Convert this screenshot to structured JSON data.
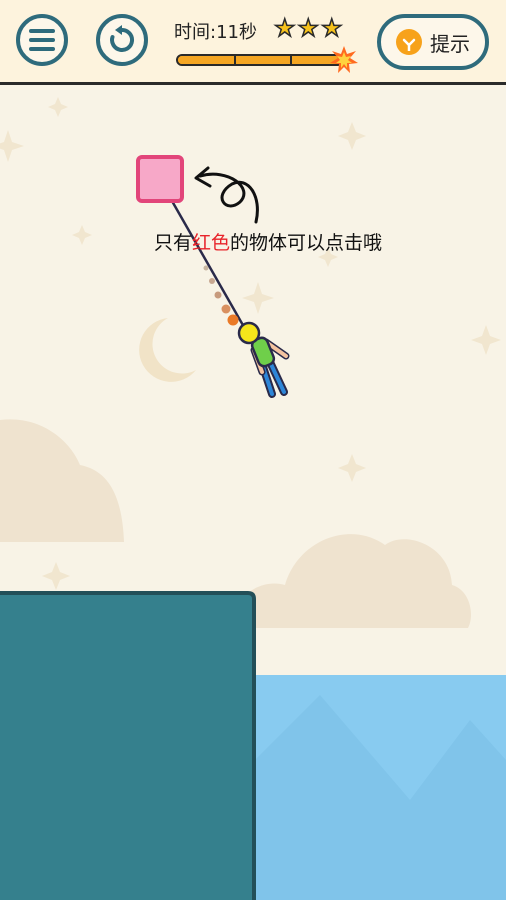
{
  "header": {
    "timer_text": "时间:11秒",
    "hint_label": "提示",
    "stars_earned": 3,
    "stars_total": 3,
    "progress_fraction": 0.92
  },
  "icons": {
    "menu": "menu-icon",
    "restart": "restart-icon",
    "hint": "lightbulb-icon",
    "star": "star-icon",
    "burst": "burst-icon"
  },
  "instruction": {
    "prefix": "只有",
    "highlight": "红色",
    "suffix": "的物体可以点击哦"
  },
  "colors": {
    "accent": "#2e6b7c",
    "platform": "#35808d",
    "water": "#88cbf0",
    "target_block": "#f7a8c8",
    "highlight_text": "#e8242b",
    "star": "#f7c21b",
    "progress": "#f5a623"
  }
}
